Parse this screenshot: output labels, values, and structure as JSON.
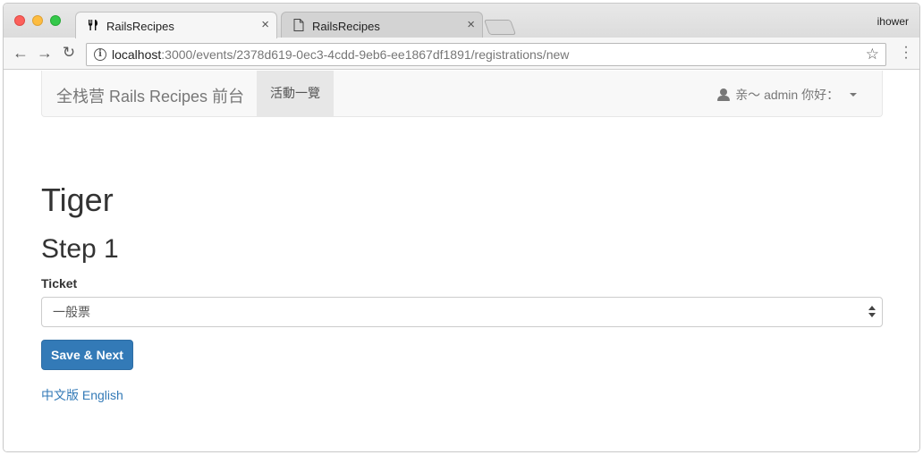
{
  "browser": {
    "tabs": [
      {
        "title": "RailsRecipes",
        "icon": "fork-knife-icon",
        "active": true
      },
      {
        "title": "RailsRecipes",
        "icon": "document-icon",
        "active": false
      }
    ],
    "close_glyph": "×",
    "profile": "ihower",
    "url_host": "localhost",
    "url_path": ":3000/events/2378d619-0ec3-4cdd-9eb6-ee1867df1891/registrations/new"
  },
  "navbar": {
    "brand": "全栈营 Rails Recipes 前台",
    "active_item": "活動一覽",
    "user_greeting": "亲～ admin 你好："
  },
  "main": {
    "event_title": "Tiger",
    "step_title": "Step 1",
    "ticket_label": "Ticket",
    "ticket_selected": "一般票",
    "submit_label": "Save & Next"
  },
  "footer": {
    "lang_zh": "中文版",
    "lang_en": "English"
  },
  "colors": {
    "primary": "#337ab7",
    "navbar_bg": "#f8f8f8",
    "nav_active_bg": "#e7e7e7"
  }
}
